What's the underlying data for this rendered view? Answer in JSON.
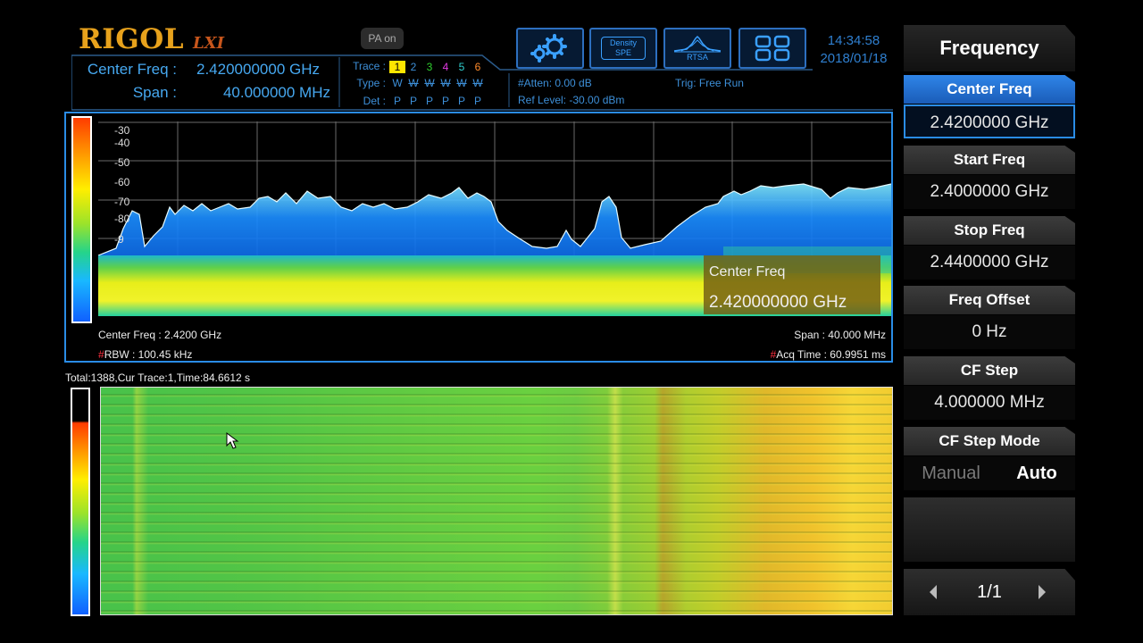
{
  "header": {
    "brand": "RIGOL",
    "brand_suffix": "LXI",
    "pa_status": "PA on",
    "center_freq_label": "Center Freq :",
    "center_freq_value": "2.420000000 GHz",
    "span_label": "Span :",
    "span_value": "40.000000 MHz",
    "trace_label": "Trace :",
    "traces": [
      "1",
      "2",
      "3",
      "4",
      "5",
      "6"
    ],
    "trace_colors": [
      "#ffe600",
      "#3d8fd8",
      "#2ed12e",
      "#e03ae0",
      "#2fd0d0",
      "#ff8a2a"
    ],
    "type_label": "Type :",
    "types": [
      "W",
      "W",
      "W",
      "W",
      "W",
      "W"
    ],
    "det_label": "Det :",
    "dets": [
      "P",
      "P",
      "P",
      "P",
      "P",
      "P"
    ],
    "atten": "#Atten: 0.00 dB",
    "ref_level": "Ref Level: -30.00 dBm",
    "trig": "Trig: Free Run",
    "time": "14:34:58",
    "date": "2018/01/18",
    "toolbar": [
      {
        "name": "settings-gear",
        "label": ""
      },
      {
        "name": "density-spe",
        "label1": "Density",
        "label2": "SPE"
      },
      {
        "name": "rtsa",
        "label": "RTSA"
      },
      {
        "name": "layout-grid",
        "label": ""
      }
    ]
  },
  "spectrum": {
    "y_ticks": [
      "-30",
      "-40",
      "-50",
      "-60",
      "-70",
      "-80",
      "-9"
    ],
    "annotation_title": "Center Freq",
    "annotation_value": "2.420000000 GHz",
    "footer_center": "Center Freq : 2.4200 GHz",
    "footer_span": "Span : 40.000 MHz",
    "footer_rbw_hash": "#",
    "footer_rbw": "RBW : 100.45 kHz",
    "footer_acq_hash": "#",
    "footer_acq": "Acq Time : 60.9951 ms"
  },
  "waterfall": {
    "status": "Total:1388,Cur Trace:1,Time:84.6612 s"
  },
  "menu": {
    "title": "Frequency",
    "items": [
      {
        "label": "Center Freq",
        "value": "2.4200000 GHz",
        "active": true
      },
      {
        "label": "Start Freq",
        "value": "2.4000000 GHz"
      },
      {
        "label": "Stop Freq",
        "value": "2.4400000 GHz"
      },
      {
        "label": "Freq Offset",
        "value": "0 Hz"
      },
      {
        "label": "CF Step",
        "value": "4.000000 MHz"
      },
      {
        "label": "CF Step Mode",
        "manual": "Manual",
        "auto": "Auto"
      }
    ],
    "page": "1/1"
  }
}
